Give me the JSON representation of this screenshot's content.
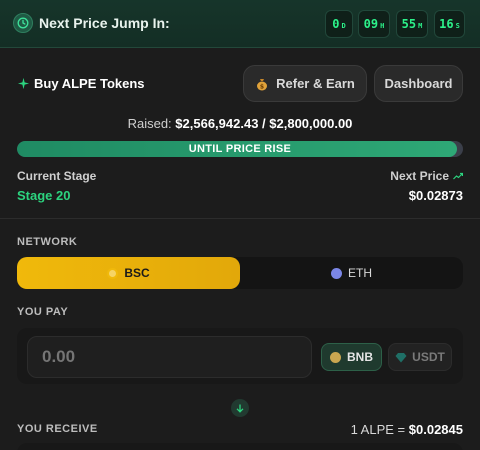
{
  "countdown": {
    "title": "Next Price Jump In:",
    "days": "0",
    "days_unit": "D",
    "hours": "09",
    "hours_unit": "H",
    "minutes": "55",
    "minutes_unit": "M",
    "seconds": "16",
    "seconds_unit": "S"
  },
  "buy": {
    "title": "Buy ALPE Tokens",
    "refer_label": "Refer & Earn",
    "dashboard_label": "Dashboard"
  },
  "raised": {
    "prefix": "Raised:",
    "amount": "$2,566,942.43 / $2,800,000.00",
    "progress_fraction": 0.9868
  },
  "progress_label": "UNTIL PRICE RISE",
  "stage": {
    "label": "Current Stage",
    "value": "Stage 20"
  },
  "next_price": {
    "label": "Next Price",
    "value": "$0.02873"
  },
  "network": {
    "label": "NETWORK",
    "options": [
      "BSC",
      "ETH"
    ],
    "selected": "BSC"
  },
  "pay": {
    "label": "YOU PAY",
    "placeholder": "0.00",
    "tokens": [
      "BNB",
      "USDT"
    ],
    "selected": "BNB"
  },
  "receive": {
    "label": "YOU RECEIVE",
    "rate_prefix": "1 ALPE =",
    "rate_value": "$0.02845"
  },
  "colors": {
    "accent_green": "#2cd47f",
    "bsc_yellow": "#f0b90b",
    "background": "#1c1c1c"
  }
}
